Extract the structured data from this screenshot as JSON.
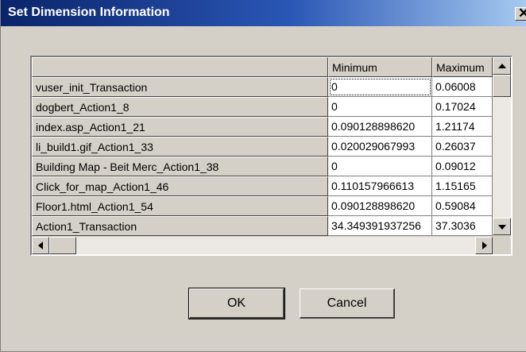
{
  "window": {
    "title": "Set Dimension Information",
    "close_glyph": "✕"
  },
  "grid": {
    "columns": [
      "",
      "Minimum",
      "Maximum"
    ],
    "rows": [
      {
        "name": "vuser_init_Transaction",
        "min": "0",
        "max": "0.06008"
      },
      {
        "name": "dogbert_Action1_8",
        "min": "0",
        "max": "0.17024"
      },
      {
        "name": "index.asp_Action1_21",
        "min": "0.090128898620",
        "max": "1.21174"
      },
      {
        "name": "li_build1.gif_Action1_33",
        "min": "0.020029067993",
        "max": "0.26037"
      },
      {
        "name": "Building Map - Beit Merc_Action1_38",
        "min": "0",
        "max": "0.09012"
      },
      {
        "name": "Click_for_map_Action1_46",
        "min": "0.110157966613",
        "max": "1.15165"
      },
      {
        "name": "Floor1.html_Action1_54",
        "min": "0.090128898620",
        "max": "0.59084"
      },
      {
        "name": "Action1_Transaction",
        "min": "34.349391937256",
        "max": "37.3036"
      }
    ],
    "selected_row": 0,
    "selected_column": "Minimum"
  },
  "buttons": {
    "ok": "OK",
    "cancel": "Cancel"
  },
  "icons": {
    "close": "close-icon",
    "scroll_up": "triangle-up-icon",
    "scroll_down": "triangle-down-icon",
    "scroll_left": "triangle-left-icon",
    "scroll_right": "triangle-right-icon"
  },
  "colors": {
    "title_bar_start": "#0a246a",
    "title_bar_end": "#a6caf0",
    "dialog_face": "#d4d0c8",
    "cell_background": "#ffffff"
  }
}
